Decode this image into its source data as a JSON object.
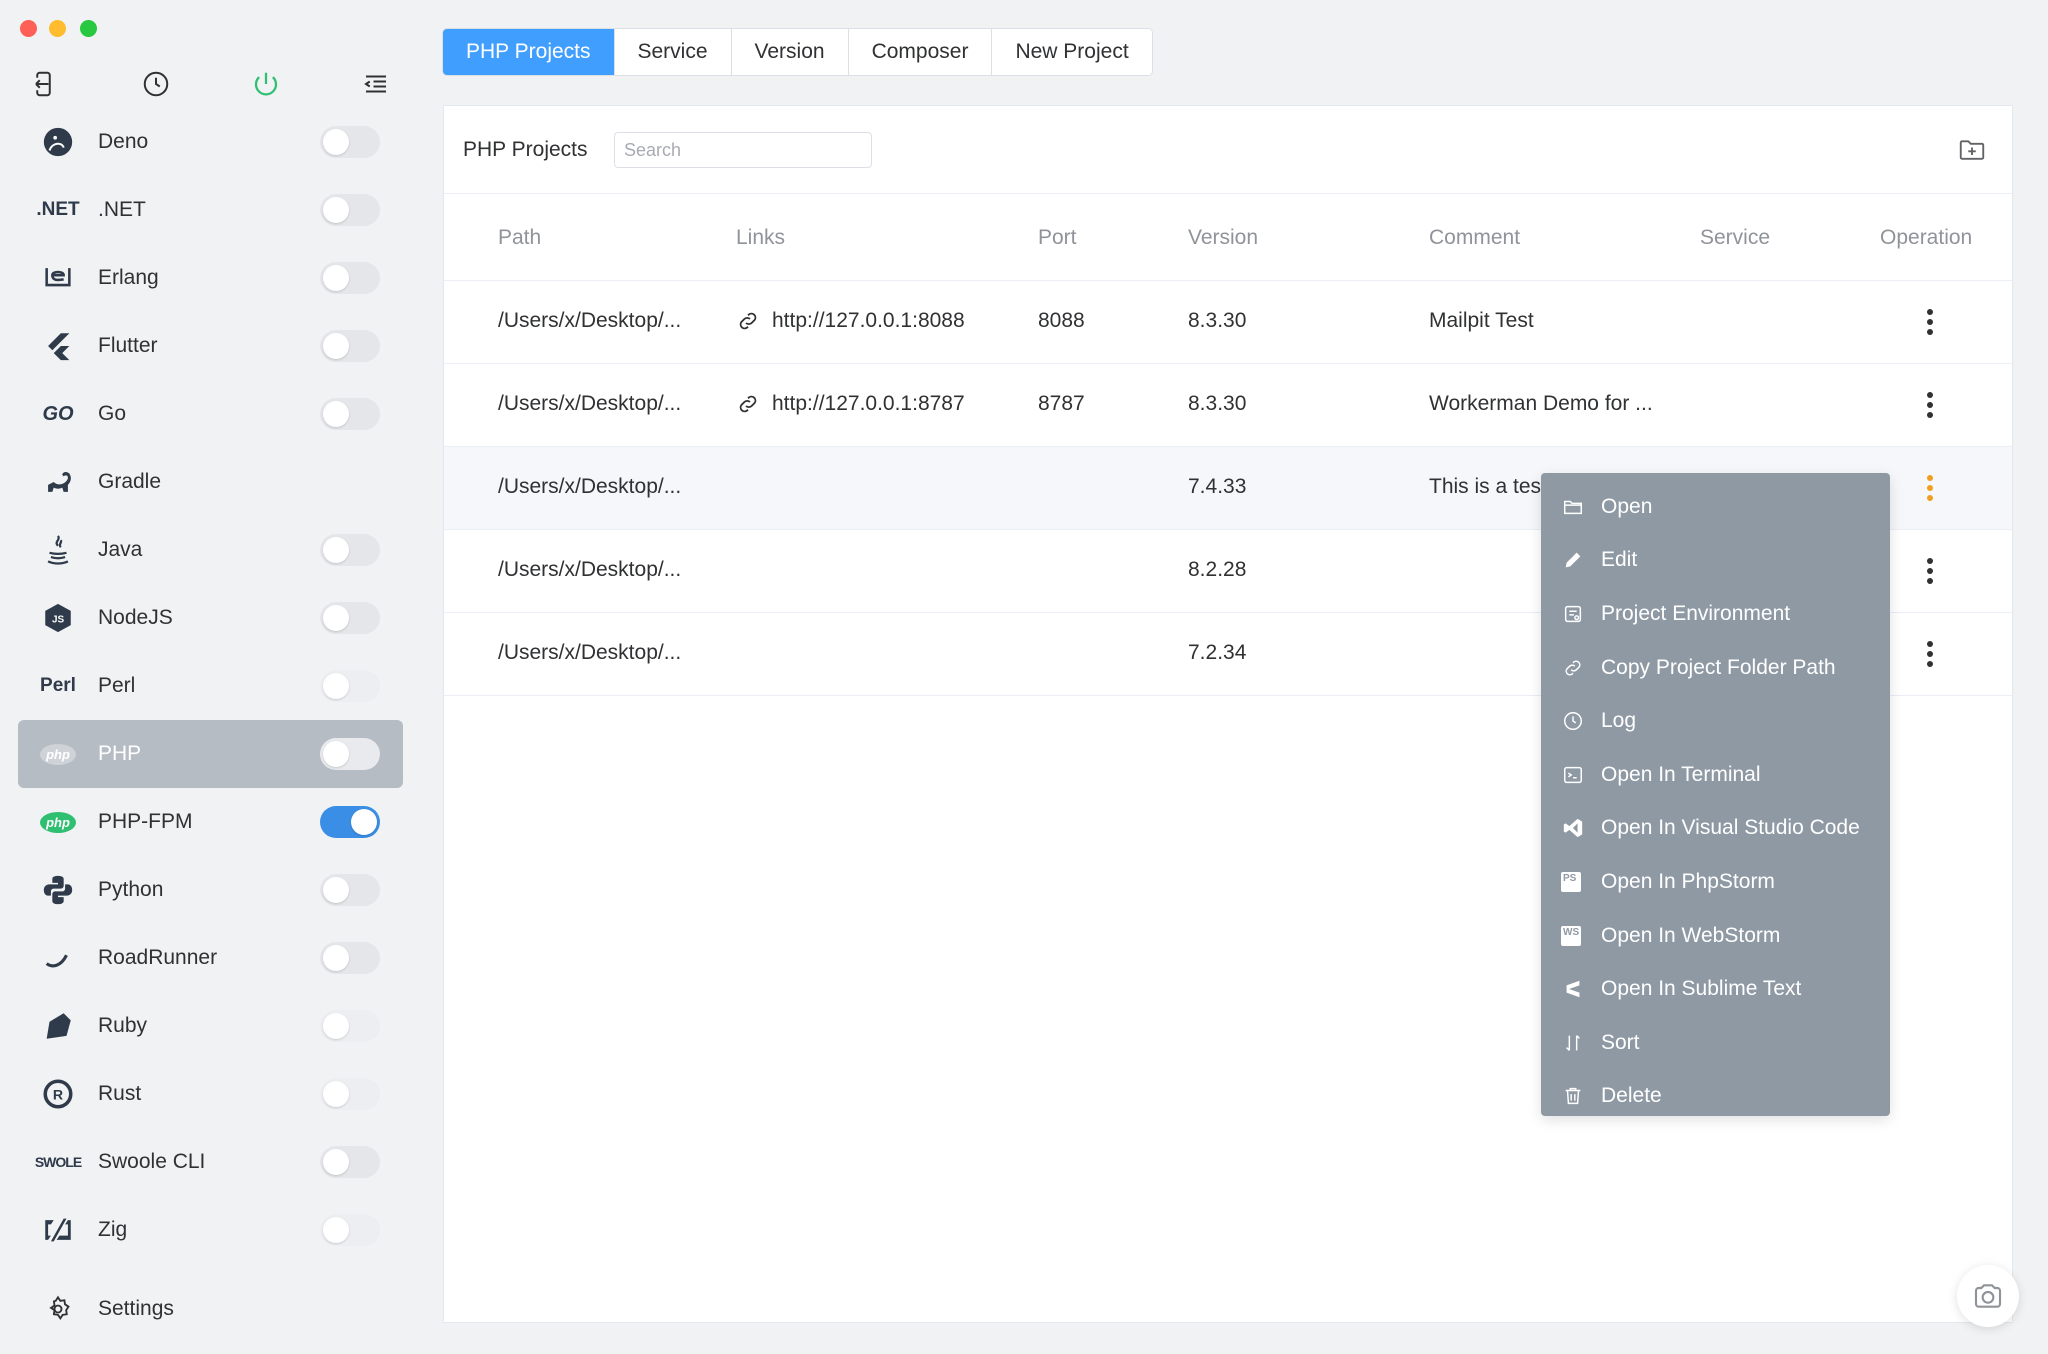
{
  "sidebar": {
    "top_icons": [
      {
        "name": "back-icon"
      },
      {
        "name": "clock-icon"
      },
      {
        "name": "power-icon"
      },
      {
        "name": "menu-indent-icon"
      }
    ],
    "items": [
      {
        "label": "Deno",
        "icon_text": "",
        "icon": "deno-icon",
        "toggle": "off"
      },
      {
        "label": ".NET",
        "icon_text": ".NET",
        "icon": "dotnet-icon",
        "toggle": "off"
      },
      {
        "label": "Erlang",
        "icon_text": "",
        "icon": "erlang-icon",
        "toggle": "off"
      },
      {
        "label": "Flutter",
        "icon_text": "",
        "icon": "flutter-icon",
        "toggle": "off"
      },
      {
        "label": "Go",
        "icon_text": "GO",
        "icon": "go-icon",
        "toggle": "off"
      },
      {
        "label": "Gradle",
        "icon_text": "",
        "icon": "gradle-icon",
        "toggle": "none"
      },
      {
        "label": "Java",
        "icon_text": "",
        "icon": "java-icon",
        "toggle": "off"
      },
      {
        "label": "NodeJS",
        "icon_text": "",
        "icon": "nodejs-icon",
        "toggle": "off"
      },
      {
        "label": "Perl",
        "icon_text": "Perl",
        "icon": "perl-icon",
        "toggle": "dim"
      },
      {
        "label": "PHP",
        "icon_text": "php",
        "icon": "php-icon",
        "toggle": "off",
        "active": true
      },
      {
        "label": "PHP-FPM",
        "icon_text": "php",
        "icon": "php-fpm-icon",
        "toggle": "on"
      },
      {
        "label": "Python",
        "icon_text": "",
        "icon": "python-icon",
        "toggle": "off"
      },
      {
        "label": "RoadRunner",
        "icon_text": "",
        "icon": "roadrunner-icon",
        "toggle": "off"
      },
      {
        "label": "Ruby",
        "icon_text": "",
        "icon": "ruby-icon",
        "toggle": "dim"
      },
      {
        "label": "Rust",
        "icon_text": "",
        "icon": "rust-icon",
        "toggle": "dim"
      },
      {
        "label": "Swoole CLI",
        "icon_text": "SWOLE",
        "icon": "swoole-icon",
        "toggle": "off"
      },
      {
        "label": "Zig",
        "icon_text": "",
        "icon": "zig-icon",
        "toggle": "dim"
      }
    ],
    "settings_label": "Settings"
  },
  "tabs": [
    {
      "label": "PHP Projects",
      "active": true
    },
    {
      "label": "Service"
    },
    {
      "label": "Version"
    },
    {
      "label": "Composer"
    },
    {
      "label": "New Project"
    }
  ],
  "panel": {
    "title": "PHP Projects",
    "search_placeholder": "Search"
  },
  "table": {
    "columns": [
      "Path",
      "Links",
      "Port",
      "Version",
      "Comment",
      "Service",
      "Operation"
    ],
    "rows": [
      {
        "path": "/Users/x/Desktop/...",
        "link": "http://127.0.0.1:8088",
        "port": "8088",
        "version": "8.3.30",
        "comment": "Mailpit Test"
      },
      {
        "path": "/Users/x/Desktop/...",
        "link": "http://127.0.0.1:8787",
        "port": "8787",
        "version": "8.3.30",
        "comment": "Workerman Demo for ..."
      },
      {
        "path": "/Users/x/Desktop/...",
        "link": "",
        "port": "",
        "version": "7.4.33",
        "comment": "This is a tes",
        "hover": true
      },
      {
        "path": "/Users/x/Desktop/...",
        "link": "",
        "port": "",
        "version": "8.2.28",
        "comment": ""
      },
      {
        "path": "/Users/x/Desktop/...",
        "link": "",
        "port": "",
        "version": "7.2.34",
        "comment": ""
      }
    ]
  },
  "context_menu": {
    "items": [
      {
        "label": "Open",
        "icon": "folder-icon"
      },
      {
        "label": "Edit",
        "icon": "pencil-icon"
      },
      {
        "label": "Project Environment",
        "icon": "environment-icon"
      },
      {
        "label": "Copy Project Folder Path",
        "icon": "copy-path-icon"
      },
      {
        "label": "Log",
        "icon": "clock-icon"
      },
      {
        "label": "Open In Terminal",
        "icon": "terminal-icon"
      },
      {
        "label": "Open In Visual Studio Code",
        "icon": "vscode-icon"
      },
      {
        "label": "Open In PhpStorm",
        "icon": "phpstorm-icon",
        "icon_text": "PS"
      },
      {
        "label": "Open In WebStorm",
        "icon": "webstorm-icon",
        "icon_text": "WS"
      },
      {
        "label": "Open In Sublime Text",
        "icon": "sublime-icon"
      },
      {
        "label": "Sort",
        "icon": "sort-icon"
      },
      {
        "label": "Delete",
        "icon": "trash-icon"
      }
    ]
  },
  "colors": {
    "accent": "#409eff",
    "menu_bg": "#8f99a4",
    "active_nav_bg": "#b6bcc3",
    "power_green": "#2fbf71",
    "toggle_on": "#3a8ee6",
    "active_operation": "#f0a020"
  }
}
